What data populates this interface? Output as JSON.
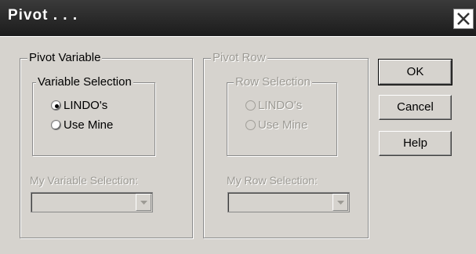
{
  "window": {
    "title": "Pivot . . ."
  },
  "pivot_variable": {
    "legend": "Pivot Variable",
    "selection_legend": "Variable Selection",
    "options": [
      "LINDO's",
      "Use Mine"
    ],
    "selected": "LINDO's",
    "my_selection_label": "My Variable Selection:",
    "my_selection_value": ""
  },
  "pivot_row": {
    "legend": "Pivot Row",
    "selection_legend": "Row Selection",
    "options": [
      "LINDO's",
      "Use Mine"
    ],
    "my_selection_label": "My Row Selection:",
    "my_selection_value": ""
  },
  "buttons": {
    "ok": "OK",
    "cancel": "Cancel",
    "help": "Help"
  },
  "icons": {
    "close": "close-icon",
    "dropdown": "chevron-down-icon"
  }
}
